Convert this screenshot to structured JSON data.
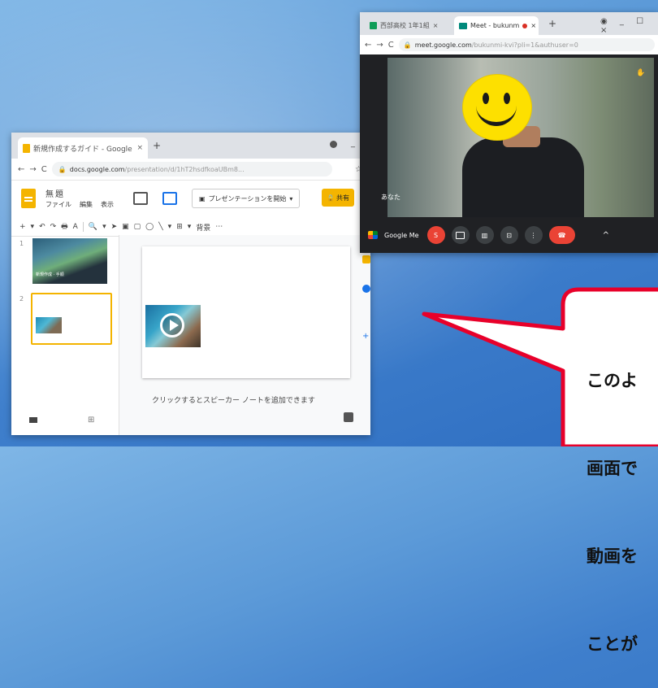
{
  "slides_window": {
    "tab_title": "新規作成するガイド - Google",
    "tab_close": "×",
    "new_tab": "+",
    "minimize": "_",
    "nav": {
      "back": "←",
      "forward": "→",
      "reload": "C"
    },
    "url_domain": "docs.google.com",
    "url_rest": "/presentation/d/1hT2hsdfkoaUBm8...",
    "star": "☆",
    "app_title": "無題",
    "menu": [
      "ファイル",
      "編集",
      "表示"
    ],
    "present_label": "プレゼンテーションを開始",
    "share_label": "共有",
    "toolbar_items": [
      "+",
      "▾",
      "↶",
      "↷",
      "🖶",
      "A",
      "🔍",
      "▾",
      "➤",
      "▣",
      "▢",
      "◯",
      "╲",
      "▾",
      "⊞",
      "▾",
      "背景",
      "⋯"
    ],
    "slide_numbers": [
      "1",
      "2"
    ],
    "thumb1_caption": "新規作成 · 手順",
    "notes_placeholder": "クリックするとスピーカー ノートを追加できます",
    "side_plus": "+",
    "grid_view_glyph": "⊞"
  },
  "meet_window": {
    "tab1_title": "西部高校 1年1組",
    "tab2_title": "Meet - bukunm",
    "tab_close": "×",
    "new_tab": "+",
    "window_controls": "◉ _ ☐ ×",
    "nav": {
      "back": "←",
      "forward": "→",
      "reload": "C"
    },
    "url_domain": "meet.google.com",
    "url_rest": "/bukunmi-kvi?pli=1&authuser=0",
    "participant_name": "あなた",
    "raise_hand": "✋",
    "control_label": "Google Me",
    "controls": [
      "S",
      "▢",
      "▥",
      "⊡",
      "⋮",
      "☎"
    ],
    "chevron": "^"
  },
  "callout": {
    "lines": [
      "このよ",
      "画面で",
      "動画を",
      "ことが"
    ]
  },
  "colors": {
    "callout_border": "#e8002a",
    "slides_accent": "#f4b400",
    "meet_hangup": "#ea4335",
    "desktop": "#3f7fcc"
  }
}
